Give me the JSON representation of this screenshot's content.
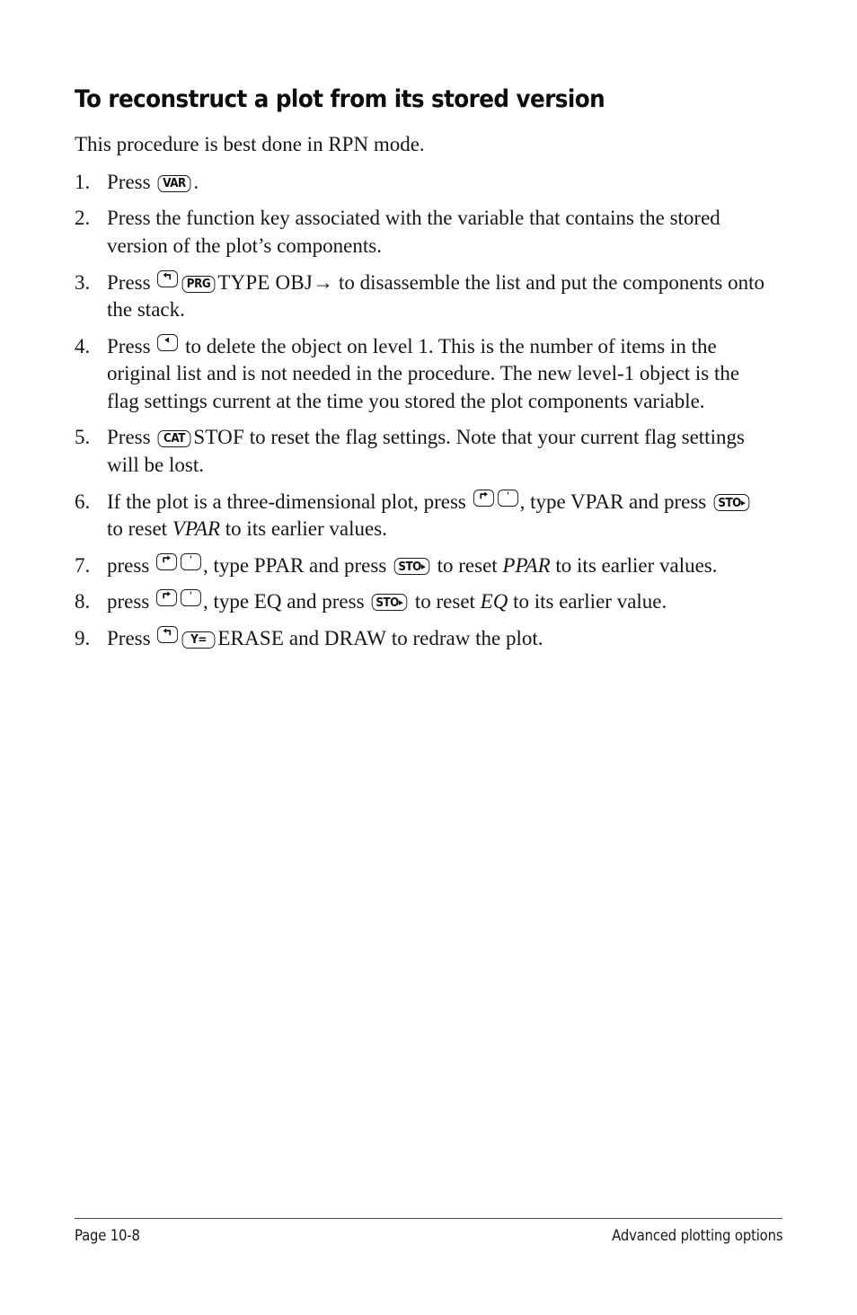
{
  "document": {
    "title": "To reconstruct a plot from its stored version",
    "intro": "This procedure is best done in RPN mode."
  },
  "keys": {
    "var": "VAR",
    "prg": "PRG",
    "cat": "CAT",
    "sto": "STO",
    "sto_arrow": "▸",
    "y_equals": "Y=",
    "left_shift": "left-shift-key",
    "right_shift": "right-shift-key",
    "tick": "tick-quote-key",
    "backspace": "backspace-delete-key"
  },
  "steps": [
    {
      "number": "1.",
      "segments": [
        {
          "type": "text",
          "value": "Press "
        },
        {
          "type": "key",
          "value": "VAR"
        },
        {
          "type": "text",
          "value": "."
        }
      ],
      "plain": "Press VAR."
    },
    {
      "number": "2.",
      "segments": [
        {
          "type": "text",
          "value": "Press the function key associated with the variable that contains the stored version of the plot’s components."
        }
      ],
      "plain": "Press the function key associated with the variable that contains the stored version of the plot’s components."
    },
    {
      "number": "3.",
      "segments": [
        {
          "type": "text",
          "value": "Press "
        },
        {
          "type": "key",
          "value": "left-shift"
        },
        {
          "type": "key",
          "value": "PRG"
        },
        {
          "type": "smallcaps",
          "value": "TYPE OBJ→"
        },
        {
          "type": "text",
          "value": " to disassemble the list and put the components onto the stack."
        }
      ],
      "plain": "Press left-shift PRG TYPE OBJ→ to disassemble the list and put the components onto the stack."
    },
    {
      "number": "4.",
      "segments": [
        {
          "type": "text",
          "value": "Press "
        },
        {
          "type": "key",
          "value": "backspace"
        },
        {
          "type": "text",
          "value": " to delete the object on level 1. This is the number of items in the original list and is not needed in the procedure. The new level-1 object is the flag settings current at the time you stored the plot components variable."
        }
      ],
      "plain": "Press backspace to delete the object on level 1. This is the number of items in the original list and is not needed in the procedure. The new level-1 object is the flag settings current at the time you stored the plot components variable."
    },
    {
      "number": "5.",
      "segments": [
        {
          "type": "text",
          "value": "Press "
        },
        {
          "type": "key",
          "value": "CAT"
        },
        {
          "type": "smallcaps",
          "value": "STOF"
        },
        {
          "type": "text",
          "value": " to reset the flag settings. Note that your current flag settings will be lost."
        }
      ],
      "plain": "Press CAT STOF to reset the flag settings. Note that your current flag settings will be lost."
    },
    {
      "number": "6.",
      "segments": [
        {
          "type": "text",
          "value": "If the plot is a three-dimensional plot, press "
        },
        {
          "type": "key",
          "value": "right-shift"
        },
        {
          "type": "key",
          "value": "tick"
        },
        {
          "type": "text",
          "value": ", type VPAR and press "
        },
        {
          "type": "key",
          "value": "STO▸"
        },
        {
          "type": "text",
          "value": " to reset "
        },
        {
          "type": "italic",
          "value": "VPAR"
        },
        {
          "type": "text",
          "value": " to its earlier values."
        }
      ],
      "plain": "If the plot is a three-dimensional plot, press right-shift tick, type VPAR and press STO▸ to reset VPAR to its earlier values."
    },
    {
      "number": "7.",
      "segments": [
        {
          "type": "text",
          "value": "press "
        },
        {
          "type": "key",
          "value": "right-shift"
        },
        {
          "type": "key",
          "value": "tick"
        },
        {
          "type": "text",
          "value": ", type PPAR and press "
        },
        {
          "type": "key",
          "value": "STO▸"
        },
        {
          "type": "text",
          "value": " to reset "
        },
        {
          "type": "italic",
          "value": "PPAR"
        },
        {
          "type": "text",
          "value": " to its earlier values."
        }
      ],
      "plain": "press right-shift tick, type PPAR and press STO▸ to reset PPAR to its earlier values."
    },
    {
      "number": "8.",
      "segments": [
        {
          "type": "text",
          "value": "press "
        },
        {
          "type": "key",
          "value": "right-shift"
        },
        {
          "type": "key",
          "value": "tick"
        },
        {
          "type": "text",
          "value": ", type EQ and press "
        },
        {
          "type": "key",
          "value": "STO▸"
        },
        {
          "type": "text",
          "value": " to reset "
        },
        {
          "type": "italic",
          "value": "EQ"
        },
        {
          "type": "text",
          "value": " to its earlier value."
        }
      ],
      "plain": "press right-shift tick, type EQ and press STO▸ to reset EQ to its earlier value."
    },
    {
      "number": "9.",
      "segments": [
        {
          "type": "text",
          "value": "Press "
        },
        {
          "type": "key",
          "value": "left-shift"
        },
        {
          "type": "key",
          "value": "Y="
        },
        {
          "type": "smallcaps",
          "value": "ERASE"
        },
        {
          "type": "text",
          "value": " and "
        },
        {
          "type": "smallcaps",
          "value": "DRAW"
        },
        {
          "type": "text",
          "value": " to redraw the plot."
        }
      ],
      "plain": "Press left-shift Y= ERASE and DRAW to redraw the plot."
    }
  ],
  "step_numbers": {
    "s1": "1.",
    "s2": "2.",
    "s3": "3.",
    "s4": "4.",
    "s5": "5.",
    "s6": "6.",
    "s7": "7.",
    "s8": "8.",
    "s9": "9."
  },
  "text_fragments": {
    "press_cap": "Press ",
    "press_low": "press ",
    "period": ".",
    "s2_body": "Press the function key associated with the variable that contains the stored version of the plot’s components.",
    "s3_sc": "TYPE OBJ→",
    "s3_tail": " to disassemble the list and put the components onto the stack.",
    "s4_tail": " to delete the object on level 1. This is the number of items in the original list and is not needed in the procedure. The new level-1 object is the flag settings current at the time you stored the plot components variable.",
    "s5_sc": "STOF",
    "s5_tail": " to reset the flag settings. Note that your current flag settings will be lost.",
    "s6_head": "If the plot is a three-dimensional plot, press ",
    "s6_mid": ", type VPAR and press ",
    "s6_reset": " to reset ",
    "s6_var": "VPAR",
    "s6_tail": " to its earlier values.",
    "s7_mid": ", type PPAR and press ",
    "s7_var": "PPAR",
    "s7_tail": " to its earlier values.",
    "s8_mid": ", type EQ and press ",
    "s8_var": "EQ",
    "s8_tail": " to its earlier value.",
    "s9_sc1": "ERASE",
    "s9_and": " and ",
    "s9_sc2": "DRAW",
    "s9_tail": " to redraw the plot."
  },
  "footer": {
    "page_label": "Page 10-8",
    "section_label": "Advanced plotting options"
  }
}
